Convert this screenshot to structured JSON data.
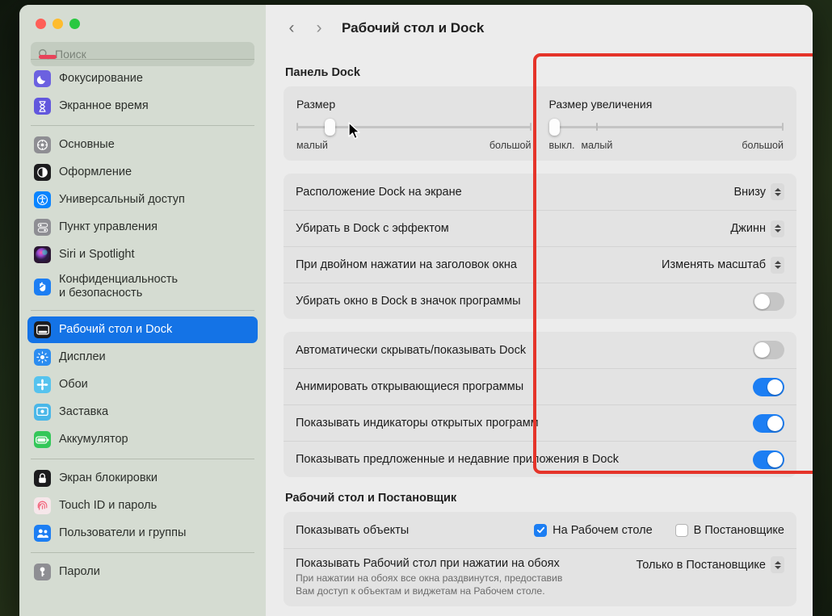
{
  "window": {
    "traffic_lights": [
      "close",
      "minimize",
      "maximize"
    ],
    "search": {
      "placeholder": "Поиск",
      "icon": "search-icon"
    }
  },
  "sidebar": {
    "groups": [
      {
        "items": [
          {
            "label": "Фокусирование",
            "icon": "moon-icon",
            "icon_bg": "#6c61e0",
            "selected": false
          },
          {
            "label": "Экранное время",
            "icon": "hourglass-icon",
            "icon_bg": "#6257dd",
            "selected": false
          }
        ]
      },
      {
        "items": [
          {
            "label": "Основные",
            "icon": "gear-icon",
            "icon_bg": "#8e8e93",
            "selected": false
          },
          {
            "label": "Оформление",
            "icon": "appearance-icon",
            "icon_bg": "#1c1c1e",
            "selected": false
          },
          {
            "label": "Универсальный доступ",
            "icon": "accessibility-icon",
            "icon_bg": "#0a84ff",
            "selected": false
          },
          {
            "label": "Пункт управления",
            "icon": "control-center-icon",
            "icon_bg": "#8e8e93",
            "selected": false
          },
          {
            "label": "Siri и Spotlight",
            "icon": "siri-icon",
            "icon_bg": "#2b1633",
            "selected": false
          },
          {
            "label": "Конфиденциальность\nи безопасность",
            "icon": "hand-shield-icon",
            "icon_bg": "#1c7ef3",
            "selected": false
          }
        ]
      },
      {
        "items": [
          {
            "label": "Рабочий стол и Dock",
            "icon": "desktop-dock-icon",
            "icon_bg": "#1c1c1e",
            "selected": true
          },
          {
            "label": "Дисплеи",
            "icon": "display-icon",
            "icon_bg": "#2b8cf0",
            "selected": false
          },
          {
            "label": "Обои",
            "icon": "wallpaper-icon",
            "icon_bg": "#56c3ee",
            "selected": false
          },
          {
            "label": "Заставка",
            "icon": "screensaver-icon",
            "icon_bg": "#49b7e8",
            "selected": false
          },
          {
            "label": "Аккумулятор",
            "icon": "battery-icon",
            "icon_bg": "#34c759",
            "selected": false
          }
        ]
      },
      {
        "items": [
          {
            "label": "Экран блокировки",
            "icon": "lock-screen-icon",
            "icon_bg": "#1c1c1e",
            "selected": false
          },
          {
            "label": "Touch ID и пароль",
            "icon": "touch-id-icon",
            "icon_bg": "#f6e7ea",
            "selected": false
          },
          {
            "label": "Пользователи и группы",
            "icon": "users-icon",
            "icon_bg": "#1c7ef3",
            "selected": false
          }
        ]
      },
      {
        "items": [
          {
            "label": "Пароли",
            "icon": "key-icon",
            "icon_bg": "#8e8e93",
            "selected": false
          }
        ]
      }
    ]
  },
  "toolbar": {
    "back_label": "‹",
    "forward_label": "›",
    "title": "Рабочий стол и Dock"
  },
  "main": {
    "dock_section": {
      "title": "Панель Dock",
      "sliders": [
        {
          "label": "Размер",
          "thumb_percent": 13,
          "legend_left": "малый",
          "legend_right": "большой",
          "has_off_label": false,
          "off_label": ""
        },
        {
          "label": "Размер увеличения",
          "thumb_percent": 0,
          "legend_left": "малый",
          "legend_right": "большой",
          "has_off_label": true,
          "off_label": "выкл."
        }
      ],
      "popup_rows": [
        {
          "label": "Расположение Dock на экране",
          "value": "Внизу",
          "control": "popup-button"
        },
        {
          "label": "Убирать в Dock с эффектом",
          "value": "Джинн",
          "control": "popup-button"
        },
        {
          "label": "При двойном нажатии на заголовок окна",
          "value": "Изменять масштаб",
          "control": "popup-button"
        },
        {
          "label": "Убирать окно в Dock в значок программы",
          "value": "off",
          "control": "toggle"
        }
      ],
      "toggle_rows": [
        {
          "label": "Автоматически скрывать/показывать Dock",
          "value": "off"
        },
        {
          "label": "Анимировать открывающиеся программы",
          "value": "on"
        },
        {
          "label": "Показывать индикаторы открытых программ",
          "value": "on"
        },
        {
          "label": "Показывать предложенные и недавние приложения в Dock",
          "value": "on"
        }
      ]
    },
    "stage_section": {
      "title": "Рабочий стол и Постановщик",
      "show_items": {
        "label": "Показывать объекты",
        "checkboxes": [
          {
            "label": "На Рабочем столе",
            "checked": true
          },
          {
            "label": "В Постановщике",
            "checked": false
          }
        ]
      },
      "click_wallpaper": {
        "label": "Показывать Рабочий стол при нажатии на обоях",
        "value": "Только в Постановщике",
        "description": "При нажатии на обоях все окна раздвинутся, предоставив\nВам доступ к объектам и виджетам на Рабочем столе."
      }
    }
  },
  "annotation": {
    "highlight_color": "#e5342a",
    "region": "dock-settings-group"
  }
}
